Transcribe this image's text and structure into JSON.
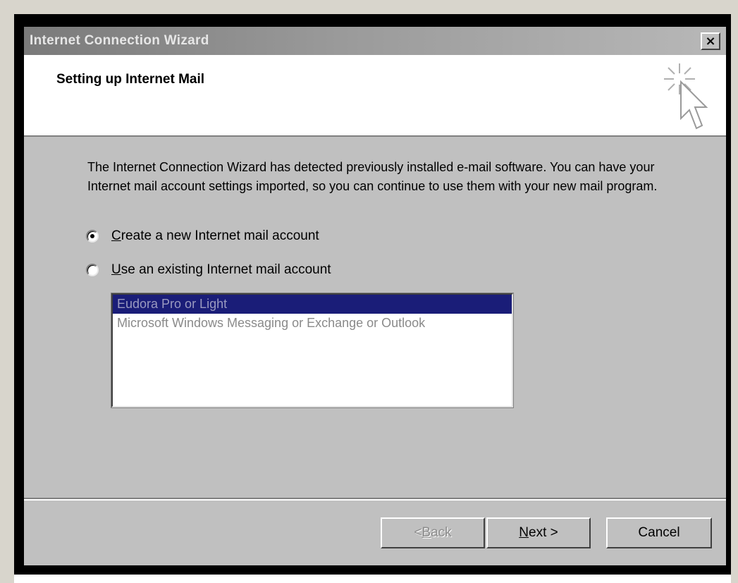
{
  "window": {
    "title": "Internet Connection Wizard",
    "close_glyph": "×"
  },
  "header": {
    "title": "Setting up Internet Mail",
    "icon": "wizard-pointer-icon"
  },
  "body": {
    "description": "The Internet Connection Wizard has detected previously installed e-mail software. You can have your Internet mail account settings imported, so you can continue to use them with your new mail program.",
    "options": [
      {
        "accel": "C",
        "rest": "reate a new Internet mail account",
        "checked": true
      },
      {
        "accel": "U",
        "rest": "se an existing Internet mail account",
        "checked": false
      }
    ],
    "list_items": [
      {
        "label": "Eudora Pro or Light",
        "selected": true
      },
      {
        "label": "Microsoft Windows Messaging or Exchange or Outlook",
        "selected": false
      }
    ]
  },
  "footer": {
    "back": {
      "pre": "< ",
      "accel": "B",
      "rest": "ack",
      "enabled": false
    },
    "next": {
      "pre": "",
      "accel": "N",
      "rest": "ext >",
      "enabled": true
    },
    "cancel": {
      "label": "Cancel",
      "enabled": true
    }
  },
  "colors": {
    "dialog_bg": "#c0c0c0",
    "selection_bg": "#1a1d78",
    "titlebar_gradient_start": "#7a7a7a"
  }
}
